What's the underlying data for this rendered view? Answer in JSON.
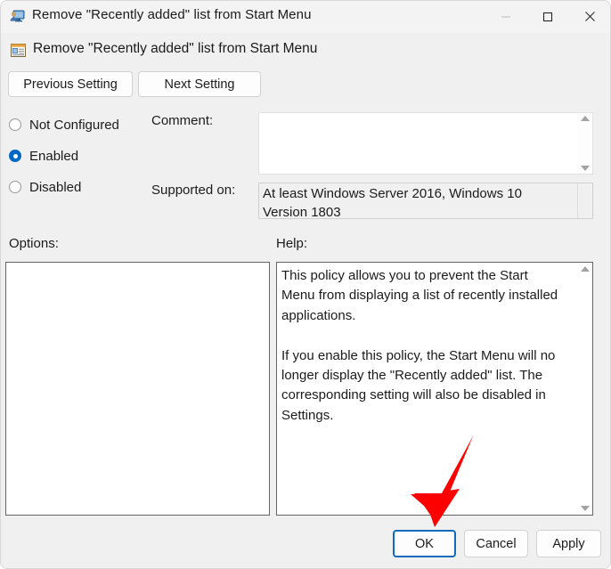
{
  "window": {
    "title": "Remove \"Recently added\" list from Start Menu",
    "icon": "policy-computer-icon",
    "controls": {
      "minimize": "minimize-icon",
      "maximize": "maximize-icon",
      "close": "close-icon"
    }
  },
  "header": {
    "icon": "policy-setting-icon",
    "title": "Remove \"Recently added\" list from Start Menu"
  },
  "nav": {
    "previous_label": "Previous Setting",
    "next_label": "Next Setting"
  },
  "state": {
    "options": [
      {
        "label": "Not Configured",
        "selected": false
      },
      {
        "label": "Enabled",
        "selected": true
      },
      {
        "label": "Disabled",
        "selected": false
      }
    ]
  },
  "comment": {
    "label": "Comment:",
    "value": "",
    "placeholder": ""
  },
  "supported_on": {
    "label": "Supported on:",
    "value": "At least Windows Server 2016, Windows 10 Version 1803"
  },
  "options_panel": {
    "label": "Options:",
    "content": ""
  },
  "help_panel": {
    "label": "Help:",
    "text": "This policy allows you to prevent the Start Menu from displaying a list of recently installed applications.\n\nIf you enable this policy, the Start Menu will no longer display the \"Recently added\" list. The corresponding setting will also be disabled in Settings."
  },
  "footer": {
    "ok_label": "OK",
    "cancel_label": "Cancel",
    "apply_label": "Apply"
  },
  "annotation": {
    "type": "arrow",
    "color": "#fd0000",
    "points_to": "ok-button"
  },
  "colors": {
    "accent": "#0268c4",
    "focus_border": "#0f6cbd",
    "window_bg": "#f0f0f0",
    "titlebar_bg": "#f3f3f3",
    "annotation_red": "#fd0000"
  }
}
